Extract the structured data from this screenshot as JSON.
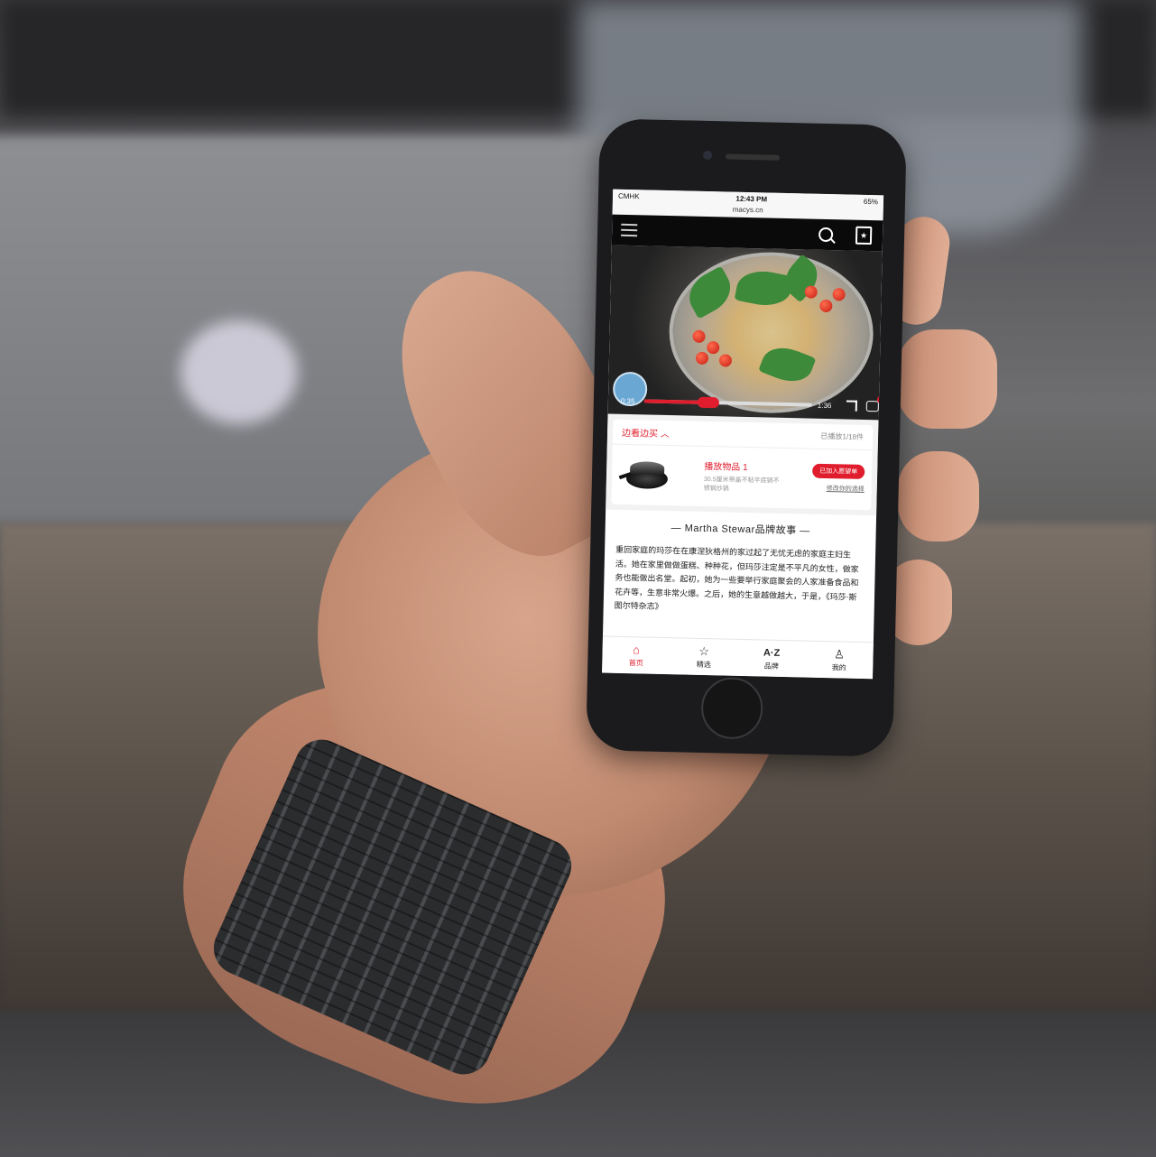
{
  "status_bar": {
    "carrier": "CMHK",
    "time": "12:43 PM",
    "battery": "65%"
  },
  "url": "macys.cn",
  "navbar": {
    "icons": [
      "menu-icon",
      "search-icon",
      "shopping-bag-icon"
    ]
  },
  "video": {
    "current_time": "0:35",
    "duration": "1:36",
    "progress": 0.38,
    "cart_count": "1"
  },
  "products_panel": {
    "header": "边看边买",
    "played_count": "已播放1/18件",
    "item": {
      "title": "播放物品 1",
      "description": "30.5厘米带盖不粘平底锅不锈钢炒锅",
      "added_label": "已加入愿望单",
      "change_label": "修改你的选择"
    }
  },
  "story": {
    "title": "— Martha Stewar品牌故事 —",
    "text": "重回家庭的玛莎在在康涅狄格州的家过起了无忧无虑的家庭主妇生活。她在家里做做蛋糕、种种花，但玛莎注定是不平凡的女性，做家务也能做出名堂。起初，她为一些要举行家庭聚会的人家准备食品和花卉等，生意非常火爆。之后，她的生意越做越大，于是，《玛莎·斯图尔特杂志》"
  },
  "tabbar": [
    {
      "label": "首页",
      "icon": "home-icon",
      "active": true
    },
    {
      "label": "精选",
      "icon": "star-icon",
      "active": false
    },
    {
      "label": "品牌",
      "icon": "az-icon",
      "active": false
    },
    {
      "label": "我的",
      "icon": "person-icon",
      "active": false
    }
  ],
  "colors": {
    "accent": "#e01d2d",
    "navbar": "#0a0a0a"
  }
}
